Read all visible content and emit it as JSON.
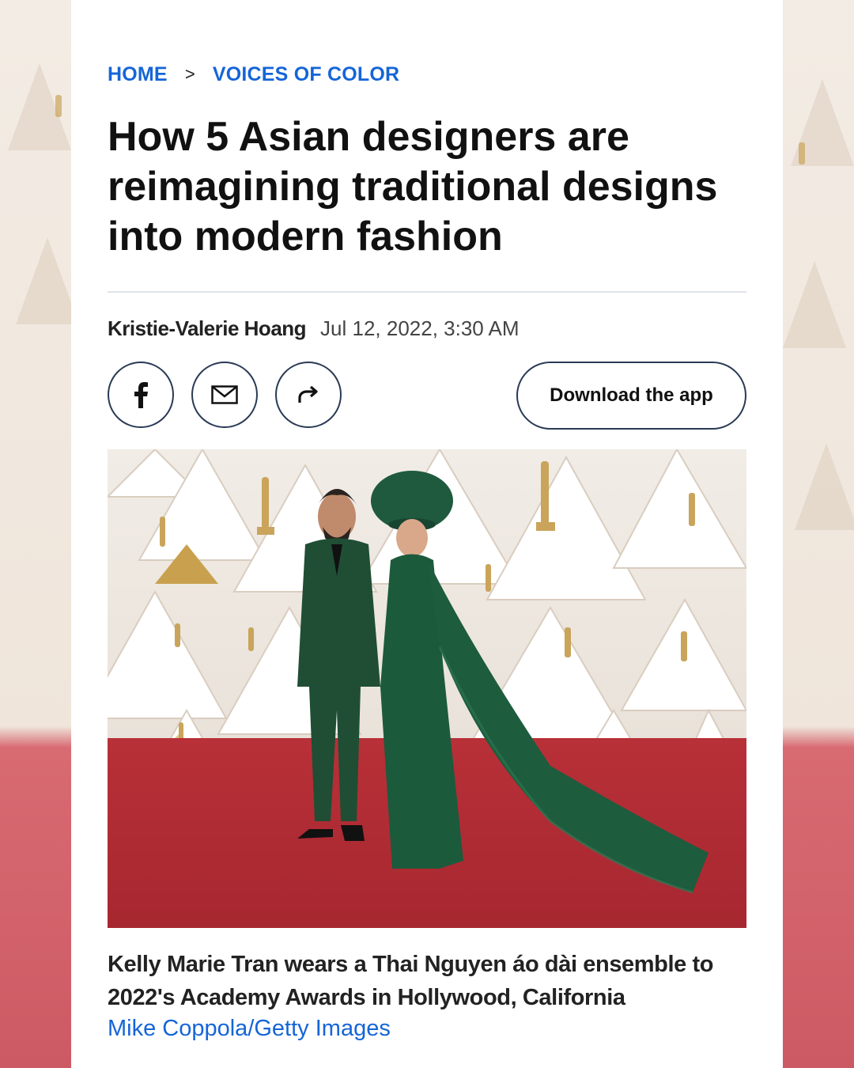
{
  "breadcrumb": {
    "home": "HOME",
    "separator": ">",
    "section": "VOICES OF COLOR"
  },
  "article": {
    "title": "How 5 Asian designers are reimagining traditional designs into modern fashion",
    "author": "Kristie-Valerie Hoang",
    "date": "Jul 12, 2022, 3:30 AM"
  },
  "share": {
    "facebook_icon": "facebook-icon",
    "email_icon": "mail-icon",
    "share_icon": "forward-arrow-icon"
  },
  "actions": {
    "download_app": "Download the app"
  },
  "photo": {
    "caption": "Kelly Marie Tran wears a Thai Nguyen áo dài ensemble to 2022's Academy Awards in Hollywood, California",
    "credit": "Mike Coppola/Getty Images"
  },
  "colors": {
    "link": "#1565d8",
    "text": "#111111",
    "carpet": "#b8323a",
    "gown": "#1f5a3e"
  }
}
